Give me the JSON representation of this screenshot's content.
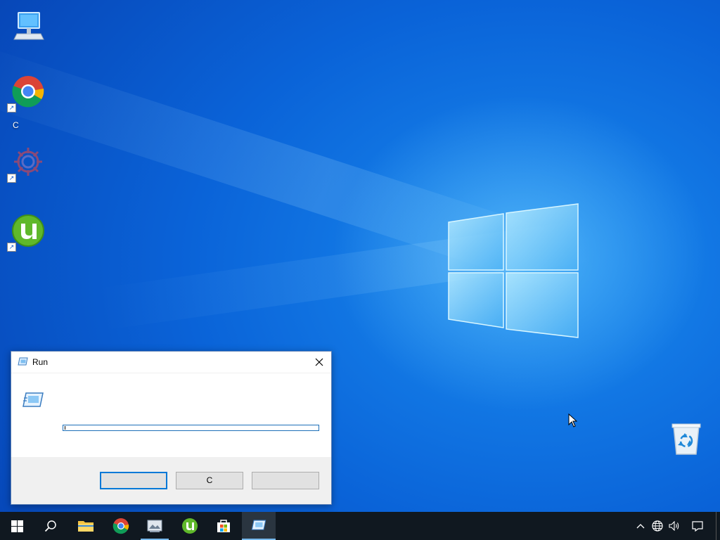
{
  "desktop": {
    "icons": [
      {
        "name": "this-pc",
        "label": ""
      },
      {
        "name": "chrome",
        "label": "C"
      },
      {
        "name": "app-gear",
        "label": ""
      },
      {
        "name": "utorrent",
        "label": ""
      },
      {
        "name": "recycle-bin",
        "label": ""
      }
    ]
  },
  "run_dialog": {
    "title": "Run",
    "input_value": "",
    "ok_label": "",
    "cancel_label": "C",
    "browse_label": ""
  },
  "taskbar": {
    "items": [
      "start-icon",
      "search-icon",
      "file-explorer-icon",
      "chrome-icon",
      "media-app-icon",
      "utorrent-icon",
      "store-icon",
      "run-icon"
    ],
    "tray": [
      "chevron-up-icon",
      "network-icon",
      "volume-icon",
      "notification-icon"
    ]
  },
  "colors": {
    "accent": "#0078d7",
    "taskbar": "#101820",
    "wallpaper": "#0a63d8"
  }
}
